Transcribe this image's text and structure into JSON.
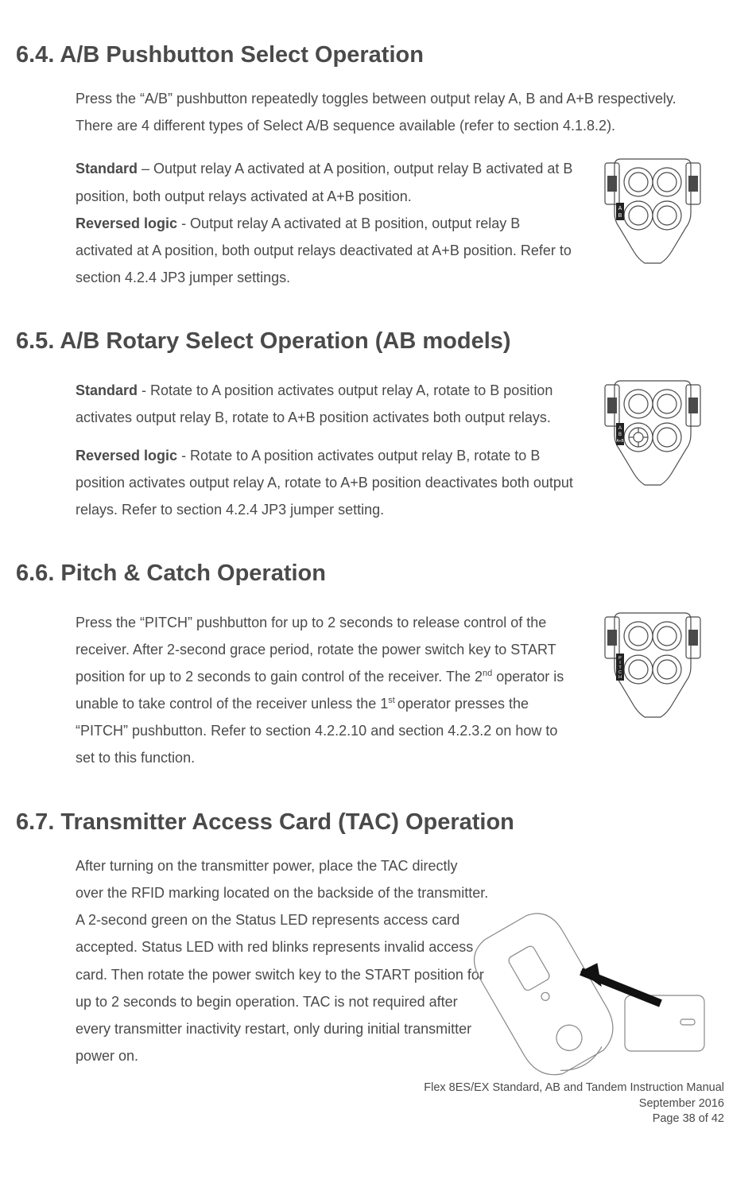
{
  "sections": {
    "s64": {
      "heading": "6.4. A/B Pushbutton Select Operation",
      "p1": "Press the “A/B” pushbutton repeatedly toggles between output relay A, B and A+B respectively.  There are 4 different types of Select A/B sequence available (refer to section 4.1.8.2).",
      "p2a_bold": "Standard",
      "p2a_rest": " – Output relay A activated at A position, output relay B activated at B position, both output relays activated at A+B position.",
      "p2b_bold": "Reversed logic",
      "p2b_rest": " - Output relay A activated at B position, output relay B activated at A position, both output relays deactivated at A+B position.  Refer to section 4.2.4 JP3 jumper settings.",
      "fig_label_a": "A",
      "fig_label_b": "B"
    },
    "s65": {
      "heading": "6.5. A/B Rotary Select Operation (AB models)",
      "p1_bold": "Standard",
      "p1_rest": " - Rotate to A position activates output relay A, rotate to B position activates output relay B, rotate to A+B position activates both output relays.",
      "p2_bold": "Reversed logic",
      "p2_rest": " - Rotate to A position activates output relay B, rotate to B position activates output relay A, rotate to A+B position deactivates both output relays.  Refer to section 4.2.4 JP3 jumper setting.",
      "fig_label_a": "A",
      "fig_label_b": "B",
      "fig_label_ab": "A+B"
    },
    "s66": {
      "heading": "6.6. Pitch & Catch Operation",
      "p1_a": "Press the “PITCH” pushbutton for up to 2 seconds to release control of the receiver.  After 2-second grace period, rotate the power switch key to START position for up to 2 seconds to gain control of the receiver.  The 2",
      "p1_sup1": "nd",
      "p1_b": " operator is unable to take control of the receiver unless the 1",
      "p1_sup2": "st ",
      "p1_c": "operator presses the “PITCH” pushbutton.  Refer to section 4.2.2.10 and section 4.2.3.2 on how to set to this function.",
      "fig_label": "PITCH"
    },
    "s67": {
      "heading": "6.7. Transmitter Access Card (TAC) Operation",
      "p1": "After turning on the transmitter power, place the TAC directly over the RFID marking located on the backside of the transmitter.  A 2-second green on the Status LED represents access card accepted.  Status LED with red blinks represents invalid access card.  Then rotate the power switch key to the START position for up to 2 seconds to begin operation.  TAC is not required after every transmitter inactivity restart, only during initial transmitter power on."
    }
  },
  "footer": {
    "line1": "Flex 8ES/EX Standard, AB and Tandem Instruction Manual",
    "line2": "September 2016",
    "line3": "Page 38 of 42"
  }
}
